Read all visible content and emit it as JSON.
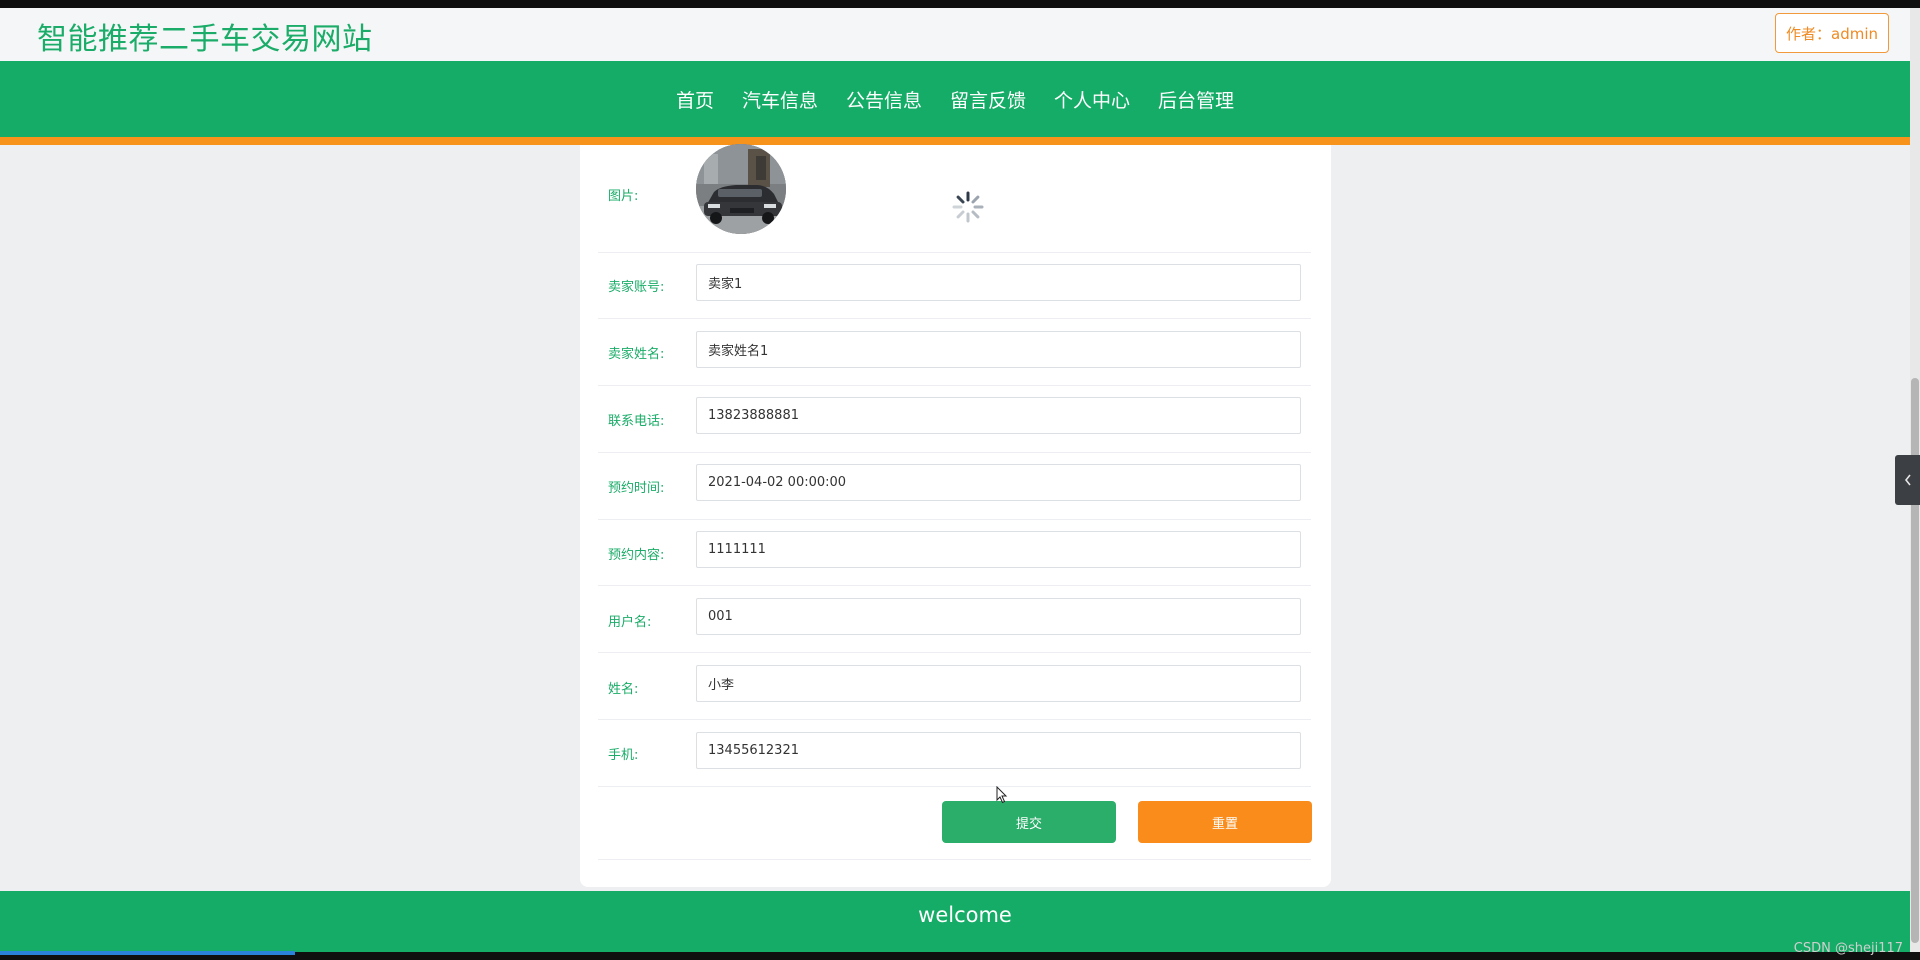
{
  "site": {
    "title": "智能推荐二手车交易网站",
    "author_label": "作者：admin"
  },
  "nav": {
    "items": [
      {
        "label": "首页"
      },
      {
        "label": "汽车信息"
      },
      {
        "label": "公告信息"
      },
      {
        "label": "留言反馈"
      },
      {
        "label": "个人中心"
      },
      {
        "label": "后台管理"
      }
    ]
  },
  "form": {
    "image_label": "图片:",
    "fields": [
      {
        "label": "卖家账号:",
        "value": "卖家1"
      },
      {
        "label": "卖家姓名:",
        "value": "卖家姓名1"
      },
      {
        "label": "联系电话:",
        "value": "13823888881"
      },
      {
        "label": "预约时间:",
        "value": "2021-04-02 00:00:00"
      },
      {
        "label": "预约内容:",
        "value": "1111111"
      },
      {
        "label": "用户名:",
        "value": "001"
      },
      {
        "label": "姓名:",
        "value": "小李"
      },
      {
        "label": "手机:",
        "value": "13455612321"
      }
    ],
    "submit_label": "提交",
    "reset_label": "重置"
  },
  "footer": {
    "text": "welcome"
  },
  "watermark": "CSDN @sheji117",
  "colors": {
    "primary": "#14ac66",
    "accent": "#f7921b",
    "label": "#1aac68"
  },
  "icons": {
    "spinner": "loading-spinner-icon",
    "side_toggle": "chevron-left-icon"
  }
}
